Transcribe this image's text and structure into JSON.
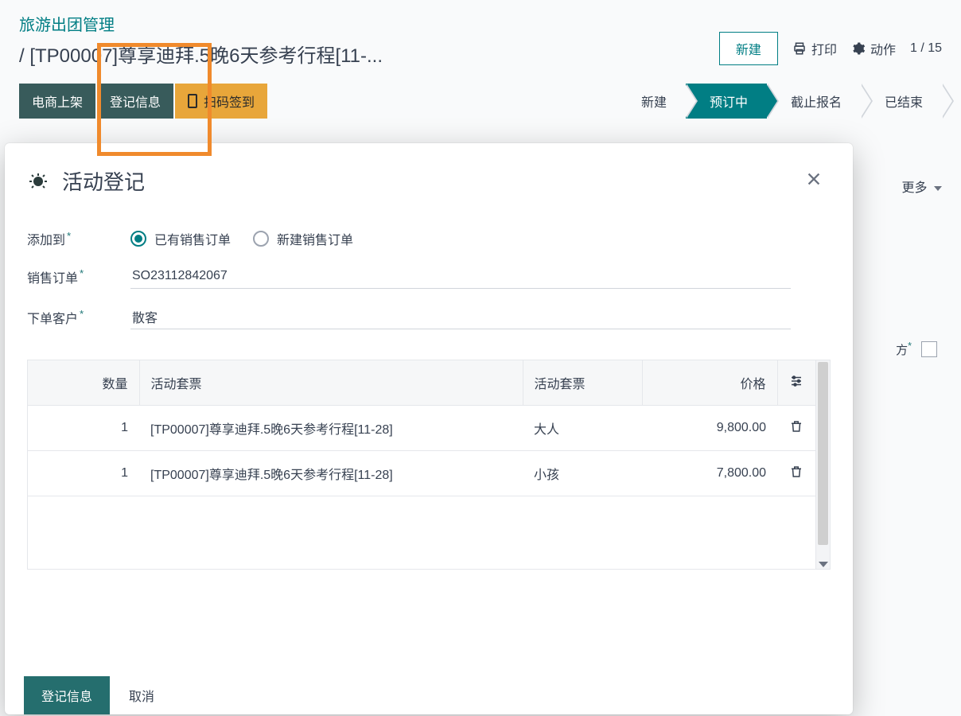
{
  "header": {
    "title": "旅游出团管理",
    "subtitle": "/ [TP00007]尊享迪拜.5晚6天参考行程[11-...",
    "new_btn": "新建",
    "print_btn": "打印",
    "action_btn": "动作",
    "pager": "1 / 15"
  },
  "actions": {
    "btn1": "电商上架",
    "btn2": "登记信息",
    "btn3": "扫码签到"
  },
  "status": {
    "steps": [
      "新建",
      "预订中",
      "截止报名",
      "已结束"
    ],
    "active_index": 1
  },
  "more_label": "更多",
  "peek_field_label": "方",
  "modal": {
    "title": "活动登记",
    "add_to_label": "添加到",
    "radio_existing": "已有销售订单",
    "radio_new": "新建销售订单",
    "sales_order_label": "销售订单",
    "sales_order_value": "SO23112842067",
    "customer_label": "下单客户",
    "customer_value": "散客",
    "table": {
      "headers": {
        "qty": "数量",
        "package1": "活动套票",
        "package2": "活动套票",
        "price": "价格"
      },
      "rows": [
        {
          "qty": "1",
          "package": "[TP00007]尊享迪拜.5晚6天参考行程[11-28]",
          "type": "大人",
          "price": "9,800.00"
        },
        {
          "qty": "1",
          "package": "[TP00007]尊享迪拜.5晚6天参考行程[11-28]",
          "type": "小孩",
          "price": "7,800.00"
        }
      ]
    },
    "footer": {
      "confirm": "登记信息",
      "cancel": "取消"
    }
  }
}
